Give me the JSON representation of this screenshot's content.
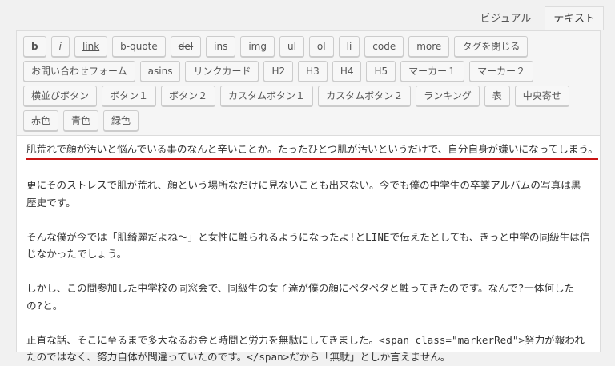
{
  "tabs": {
    "visual": "ビジュアル",
    "text": "テキスト"
  },
  "toolbar": {
    "rows": [
      [
        "b",
        "i",
        "link",
        "b-quote",
        "del",
        "ins",
        "img",
        "ul",
        "ol",
        "li",
        "code",
        "more",
        "タグを閉じる"
      ],
      [
        "お問い合わせフォーム",
        "asins",
        "リンクカード",
        "H2",
        "H3",
        "H4",
        "H5",
        "マーカー１",
        "マーカー２"
      ],
      [
        "横並びボタン",
        "ボタン１",
        "ボタン２",
        "カスタムボタン１",
        "カスタムボタン２",
        "ランキング",
        "表",
        "中央寄せ"
      ],
      [
        "赤色",
        "青色",
        "緑色"
      ]
    ]
  },
  "content": {
    "paragraphs": [
      "肌荒れで顔が汚いと悩んでいる事のなんと辛いことか。たったひとつ肌が汚いというだけで、自分自身が嫌いになってしまう。",
      "更にそのストレスで肌が荒れ、顔という場所なだけに見ないことも出来ない。今でも僕の中学生の卒業アルバムの写真は黒歴史です。",
      "そんな僕が今では「肌綺麗だよね〜」と女性に触られるようになったよ!とLINEで伝えたとしても、きっと中学の同級生は信じなかったでしょう。",
      "しかし、この間参加した中学校の同窓会で、同級生の女子達が僕の顔にペタペタと触ってきたのです。なんで?一体何したの?と。",
      "正直な話、そこに至るまで多大なるお金と時間と労力を無駄にしてきました。<span class=\"markerRed\">努力が報われたのではなく、努力自体が間違っていたのです。</span>だから「無駄」としか言えません。"
    ]
  },
  "colors": {
    "underline": "#c91414"
  }
}
